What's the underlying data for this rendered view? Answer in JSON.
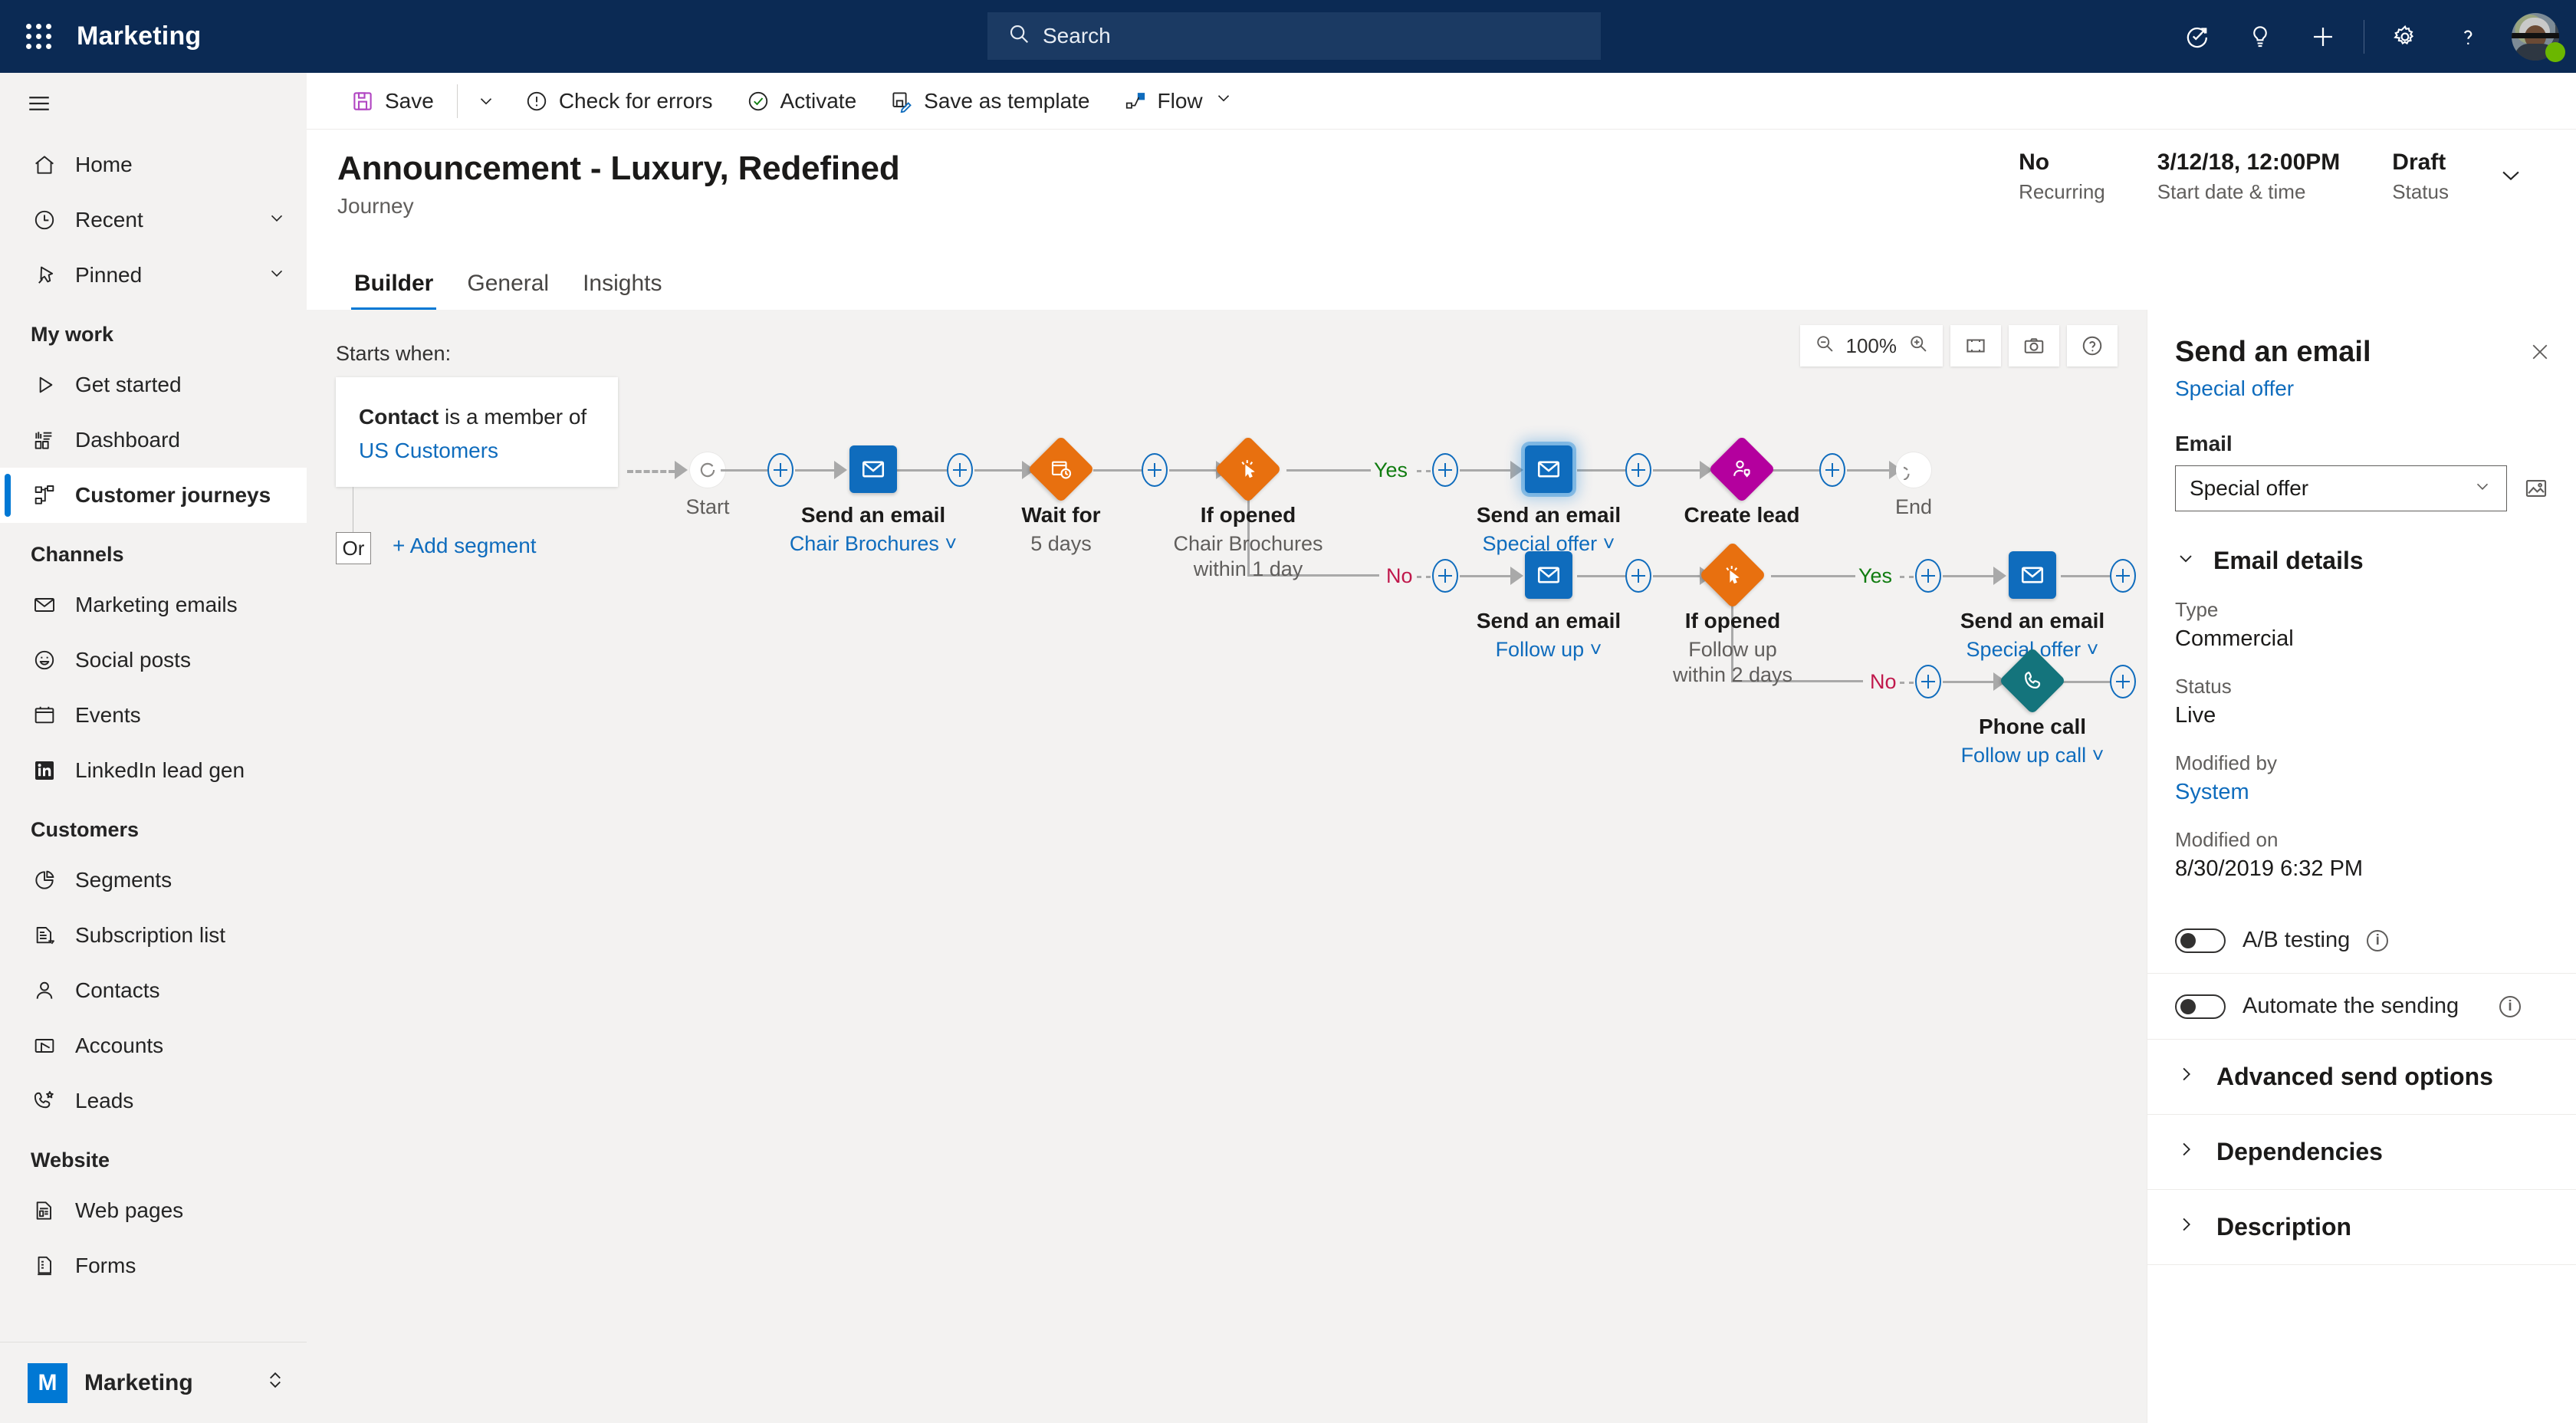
{
  "topbar": {
    "waffle_icon": "waffle-grid-icon",
    "app_title": "Marketing",
    "search": {
      "icon": "search-icon",
      "placeholder": "Search",
      "value": ""
    },
    "actions": [
      {
        "name": "guided-help-icon",
        "label": ""
      },
      {
        "name": "idea-lightbulb-icon",
        "label": ""
      },
      {
        "name": "quick-create-plus-icon",
        "label": ""
      },
      {
        "name": "settings-gear-icon",
        "label": ""
      },
      {
        "name": "help-question-icon",
        "label": ""
      }
    ],
    "avatar": {
      "name": "user-avatar",
      "presence": "available",
      "presence_color": "#6bb700"
    }
  },
  "sidebar": {
    "hamburger_icon": "hamburger-menu-icon",
    "items": [
      {
        "label": "Home",
        "icon": "home-icon",
        "type": "item",
        "selected": false,
        "chevron": false
      },
      {
        "label": "Recent",
        "icon": "clock-icon",
        "type": "item",
        "selected": false,
        "chevron": true
      },
      {
        "label": "Pinned",
        "icon": "pin-icon",
        "type": "item",
        "selected": false,
        "chevron": true
      },
      {
        "label": "My work",
        "icon": "",
        "type": "group"
      },
      {
        "label": "Get started",
        "icon": "play-icon",
        "type": "item",
        "selected": false,
        "chevron": false
      },
      {
        "label": "Dashboard",
        "icon": "dashboard-icon",
        "type": "item",
        "selected": false,
        "chevron": false
      },
      {
        "label": "Customer journeys",
        "icon": "journey-icon",
        "type": "item",
        "selected": true,
        "chevron": false
      },
      {
        "label": "Channels",
        "icon": "",
        "type": "group"
      },
      {
        "label": "Marketing emails",
        "icon": "envelope-icon",
        "type": "item",
        "selected": false,
        "chevron": false
      },
      {
        "label": "Social posts",
        "icon": "social-smiley-icon",
        "type": "item",
        "selected": false,
        "chevron": false
      },
      {
        "label": "Events",
        "icon": "calendar-icon",
        "type": "item",
        "selected": false,
        "chevron": false
      },
      {
        "label": "LinkedIn lead gen",
        "icon": "linkedin-icon",
        "type": "item",
        "selected": false,
        "chevron": false
      },
      {
        "label": "Customers",
        "icon": "",
        "type": "group"
      },
      {
        "label": "Segments",
        "icon": "pie-chart-icon",
        "type": "item",
        "selected": false,
        "chevron": false
      },
      {
        "label": "Subscription list",
        "icon": "list-doc-icon",
        "type": "item",
        "selected": false,
        "chevron": false
      },
      {
        "label": "Contacts",
        "icon": "person-icon",
        "type": "item",
        "selected": false,
        "chevron": false
      },
      {
        "label": "Accounts",
        "icon": "accounts-icon",
        "type": "item",
        "selected": false,
        "chevron": false
      },
      {
        "label": "Leads",
        "icon": "lead-phone-icon",
        "type": "item",
        "selected": false,
        "chevron": false
      },
      {
        "label": "Website",
        "icon": "",
        "type": "group"
      },
      {
        "label": "Web pages",
        "icon": "webpage-icon",
        "type": "item",
        "selected": false,
        "chevron": false
      },
      {
        "label": "Forms",
        "icon": "form-icon",
        "type": "item",
        "selected": false,
        "chevron": false
      }
    ],
    "footer": {
      "badge": "M",
      "label": "Marketing",
      "switch_icon": "up-down-chevron-icon"
    }
  },
  "commandbar": {
    "save_label": "Save",
    "save_icon": "save-disk-icon",
    "save_caret_icon": "chevron-down-icon",
    "items": [
      {
        "label": "Check for errors",
        "icon": "error-circle-icon"
      },
      {
        "label": "Activate",
        "icon": "check-circle-icon"
      },
      {
        "label": "Save as template",
        "icon": "save-template-icon"
      },
      {
        "label": "Flow",
        "icon": "flow-icon",
        "caret": true
      }
    ]
  },
  "page": {
    "title": "Announcement - Luxury, Redefined",
    "subtitle": "Journey",
    "meta": [
      {
        "value": "No",
        "label": "Recurring"
      },
      {
        "value": "3/12/18, 12:00PM",
        "label": "Start date & time"
      },
      {
        "value": "Draft",
        "label": "Status"
      }
    ],
    "meta_chevron_icon": "chevron-down-icon",
    "tabs": [
      {
        "label": "Builder",
        "active": true
      },
      {
        "label": "General",
        "active": false
      },
      {
        "label": "Insights",
        "active": false
      }
    ]
  },
  "canvas": {
    "zoom_out_icon": "zoom-out-icon",
    "zoom_level": "100%",
    "zoom_in_icon": "zoom-in-icon",
    "fit_icon": "fit-to-screen-icon",
    "snapshot_icon": "camera-icon",
    "help_icon": "help-circle-icon",
    "starts_when_label": "Starts when:",
    "trigger": {
      "entity": "Contact",
      "predicate": "is a member of",
      "segment": "US Customers"
    },
    "or_label": "Or",
    "add_segment_label": "+ Add segment",
    "start_label": "Start",
    "end_label": "End",
    "branch_yes": "Yes",
    "branch_no": "No",
    "nodes": [
      {
        "id": "n1",
        "title": "Send an email",
        "sub": "Chair Brochures",
        "sub_kind": "link",
        "extra": "",
        "shape": "square",
        "color": "#0f6cbd",
        "icon": "envelope-icon",
        "selected": false
      },
      {
        "id": "n2",
        "title": "Wait for",
        "sub": "5 days",
        "sub_kind": "muted",
        "extra": "",
        "shape": "diamond",
        "color": "#e8700f",
        "icon": "wait-clock-icon",
        "selected": false
      },
      {
        "id": "n3",
        "title": "If opened",
        "sub": "Chair Brochures",
        "sub_kind": "muted",
        "extra": "within 1 day",
        "shape": "diamond",
        "color": "#e8700f",
        "icon": "click-cursor-icon",
        "selected": false
      },
      {
        "id": "n4",
        "title": "Send an email",
        "sub": "Special offer",
        "sub_kind": "link",
        "extra": "",
        "shape": "square",
        "color": "#0f6cbd",
        "icon": "envelope-icon",
        "selected": true
      },
      {
        "id": "n5",
        "title": "Create lead",
        "sub": "",
        "sub_kind": "none",
        "extra": "",
        "shape": "diamond",
        "color": "#b4009e",
        "icon": "create-lead-icon",
        "selected": false
      },
      {
        "id": "n6",
        "title": "Send an email",
        "sub": "Follow up",
        "sub_kind": "link",
        "extra": "",
        "shape": "square",
        "color": "#0f6cbd",
        "icon": "envelope-icon",
        "selected": false
      },
      {
        "id": "n7",
        "title": "If opened",
        "sub": "Follow up",
        "sub_kind": "muted",
        "extra": "within 2 days",
        "shape": "diamond",
        "color": "#e8700f",
        "icon": "click-cursor-icon",
        "selected": false
      },
      {
        "id": "n8",
        "title": "Send an email",
        "sub": "Special offer",
        "sub_kind": "link",
        "extra": "",
        "shape": "square",
        "color": "#0f6cbd",
        "icon": "envelope-icon",
        "selected": false
      },
      {
        "id": "n9",
        "title": "Phone call",
        "sub": "Follow up call",
        "sub_kind": "link",
        "extra": "",
        "shape": "diamond",
        "color": "#14747c",
        "icon": "phone-icon",
        "selected": false
      }
    ]
  },
  "rightpanel": {
    "title": "Send an email",
    "subtitle": "Special offer",
    "close_icon": "close-icon",
    "email_field_label": "Email",
    "email_value": "Special offer",
    "email_caret_icon": "chevron-down-icon",
    "preview_icon": "image-preview-icon",
    "details_section": {
      "label": "Email details",
      "chevron_icon": "chevron-down-icon",
      "fields": [
        {
          "key": "Type",
          "value": "Commercial",
          "link": false
        },
        {
          "key": "Status",
          "value": "Live",
          "link": false
        },
        {
          "key": "Modified by",
          "value": "System",
          "link": true
        },
        {
          "key": "Modified on",
          "value": "8/30/2019  6:32 PM",
          "link": false
        }
      ]
    },
    "toggles": [
      {
        "label": "A/B testing",
        "on": false,
        "info_icon": "info-icon"
      },
      {
        "label": "Automate the sending",
        "on": false,
        "info_icon": "info-icon",
        "info_right": true
      }
    ],
    "accordions": [
      {
        "label": "Advanced send options",
        "chevron_icon": "chevron-right-icon"
      },
      {
        "label": "Dependencies",
        "chevron_icon": "chevron-right-icon"
      },
      {
        "label": "Description",
        "chevron_icon": "chevron-right-icon"
      }
    ]
  },
  "colors": {
    "nav_blue": "#0b2a54",
    "accent": "#0078d4",
    "link": "#0f6cbd",
    "email_node": "#0f6cbd",
    "condition_node": "#e8700f",
    "lead_node": "#b4009e",
    "phone_node": "#14747c",
    "yes_green": "#107c10",
    "no_red": "#c0184b",
    "canvas_bg": "#f3f2f1"
  }
}
